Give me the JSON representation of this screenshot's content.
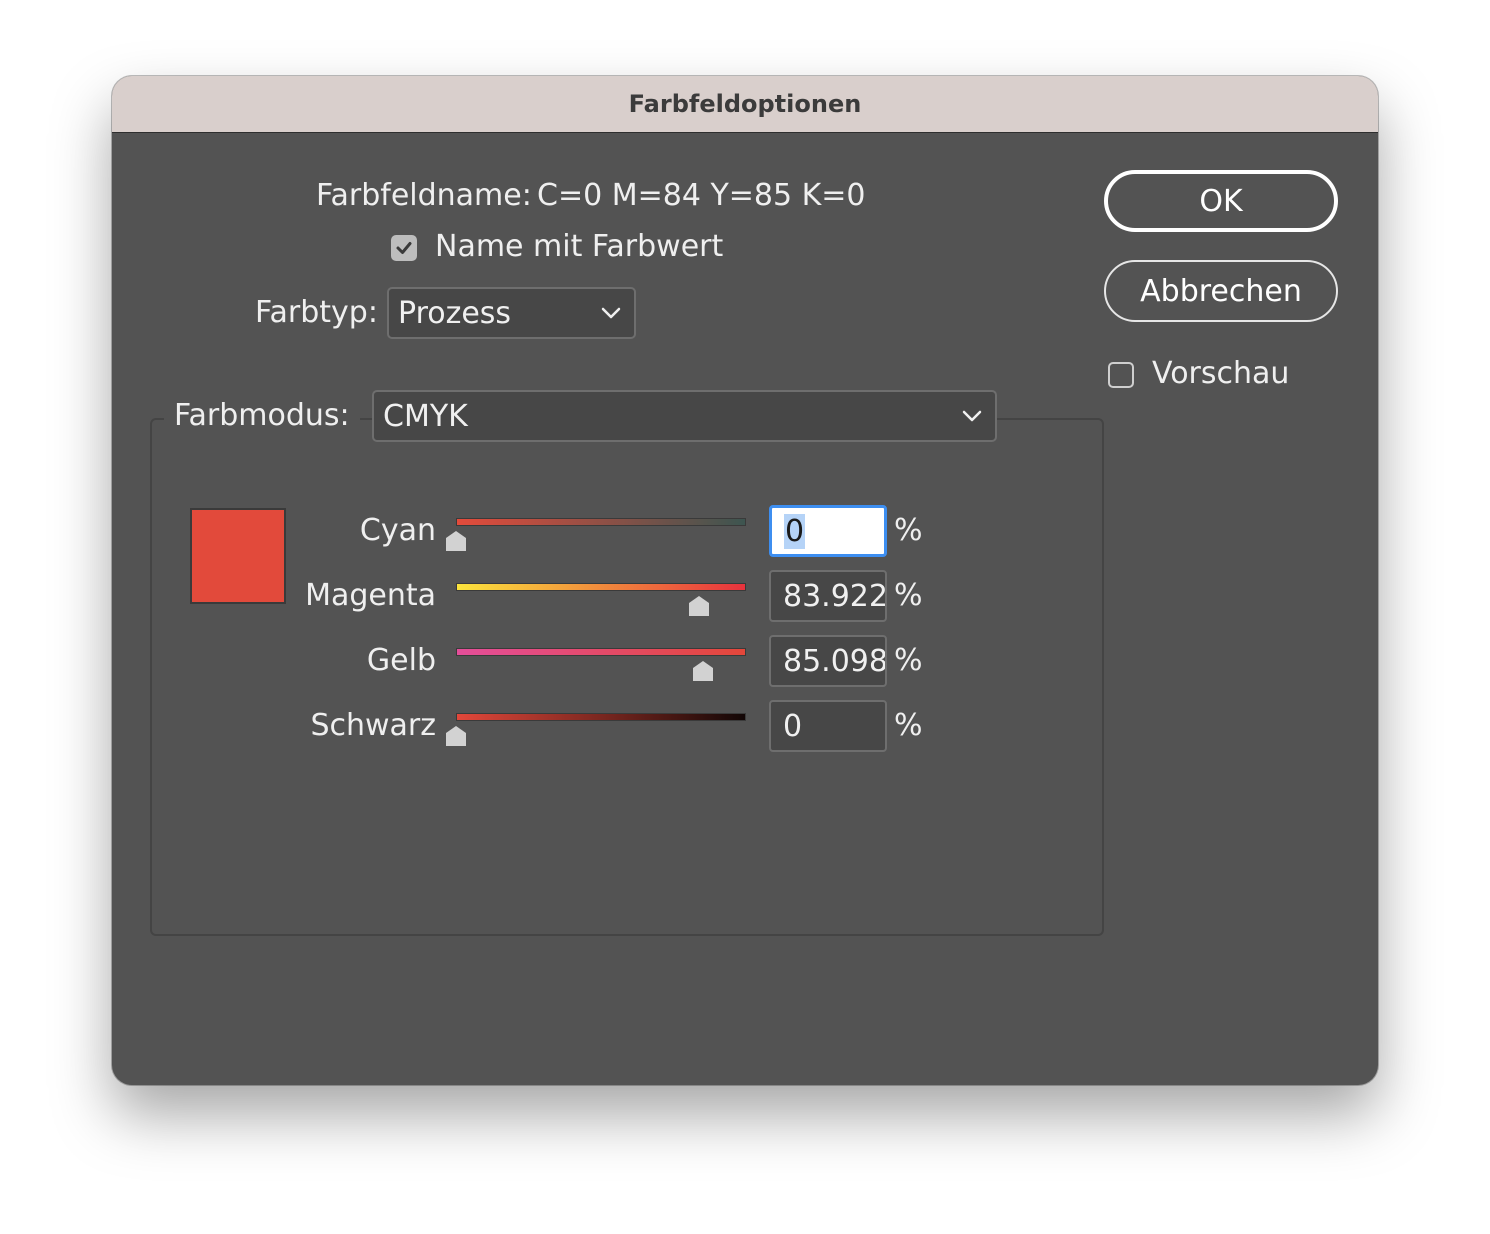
{
  "window": {
    "title": "Farbfeldoptionen"
  },
  "swatch_name": {
    "label": "Farbfeldname:",
    "value": "C=0 M=84 Y=85 K=0"
  },
  "name_with_value": {
    "label": "Name mit Farbwert",
    "checked": true
  },
  "color_type": {
    "label": "Farbtyp:",
    "value": "Prozess"
  },
  "color_mode": {
    "label": "Farbmodus:",
    "value": "CMYK"
  },
  "preview_color": "#e24a3b",
  "channels": [
    {
      "label": "Cyan",
      "value": "0",
      "unit": "%",
      "level": 0,
      "gradient": [
        "#e44b3b",
        "#3d5550"
      ],
      "active": true
    },
    {
      "label": "Magenta",
      "value": "83.922",
      "unit": "%",
      "level": 0.83922,
      "gradient": [
        "#fbe43c",
        "#e8323d"
      ],
      "active": false
    },
    {
      "label": "Gelb",
      "value": "85.098",
      "unit": "%",
      "level": 0.85098,
      "gradient": [
        "#e54e9a",
        "#e4473a"
      ],
      "active": false
    },
    {
      "label": "Schwarz",
      "value": "0",
      "unit": "%",
      "level": 0,
      "gradient": [
        "#e3473a",
        "#120605"
      ],
      "active": false
    }
  ],
  "buttons": {
    "ok": "OK",
    "cancel": "Abbrechen"
  },
  "preview": {
    "label": "Vorschau",
    "checked": false
  }
}
